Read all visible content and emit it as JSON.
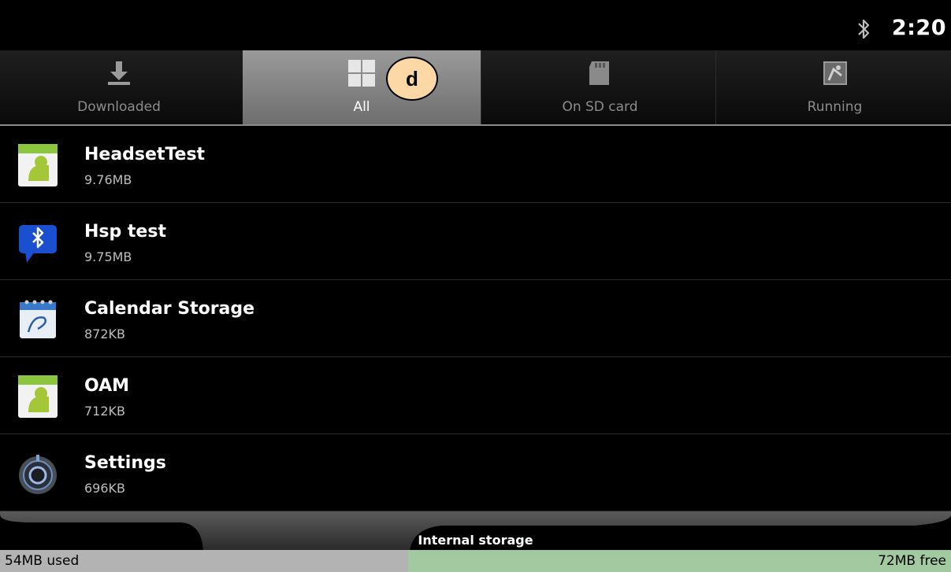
{
  "status_bar": {
    "time": "2:20",
    "bluetooth_icon": "bluetooth-icon"
  },
  "tabs": [
    {
      "label": "Downloaded",
      "icon": "download-icon",
      "active": false
    },
    {
      "label": "All",
      "icon": "grid-icon",
      "active": true
    },
    {
      "label": "On SD card",
      "icon": "sd-card-icon",
      "active": false
    },
    {
      "label": "Running",
      "icon": "running-icon",
      "active": false
    }
  ],
  "annotation": {
    "label": "d"
  },
  "apps": [
    {
      "name": "HeadsetTest",
      "size": "9.76MB",
      "icon": "android-app-icon"
    },
    {
      "name": "Hsp test",
      "size": "9.75MB",
      "icon": "bluetooth-chat-icon"
    },
    {
      "name": "Calendar Storage",
      "size": "872KB",
      "icon": "calendar-icon"
    },
    {
      "name": "OAM",
      "size": "712KB",
      "icon": "android-app-icon"
    },
    {
      "name": "Settings",
      "size": "696KB",
      "icon": "settings-knob-icon"
    }
  ],
  "storage": {
    "title": "Internal storage",
    "used": "54MB used",
    "free": "72MB free",
    "free_fraction": 0.571,
    "used_color": "#b3b3b3",
    "free_color": "#a3c9a0"
  }
}
